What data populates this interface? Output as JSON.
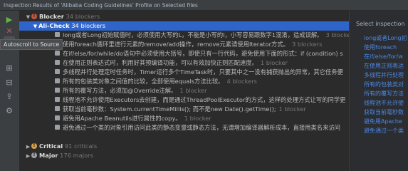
{
  "window": {
    "title": "Inspection Results of 'Alibaba Coding Guidelines' Profile on Selected files"
  },
  "toolbar": {
    "tooltip": "Autoscroll to Source",
    "buttons": [
      {
        "icon": "rerun-icon",
        "glyph": "▶"
      },
      {
        "icon": "close-icon",
        "glyph": "✕"
      },
      {
        "icon": "autoscroll-icon",
        "glyph": "⇥"
      },
      {
        "icon": "expand-all-icon",
        "glyph": "⊞"
      },
      {
        "icon": "collapse-all-icon",
        "glyph": "⊟"
      },
      {
        "icon": "export-icon",
        "glyph": "⇪"
      },
      {
        "icon": "filter-icon",
        "glyph": "⚙"
      },
      {
        "icon": "settings-icon",
        "glyph": "⚙"
      }
    ]
  },
  "tree": {
    "blocker_group": {
      "label": "Blocker",
      "count": "34 blockers"
    },
    "alicheck": {
      "label": "Ali-Check",
      "count": "34 blockers"
    },
    "items": [
      {
        "text": "long或者Long初始赋值时，必须使用大写的L，不能是小写的l，小写容易跟数字1混淆，造成误解。",
        "count": "3 blockers"
      },
      {
        "text": "使用foreach循环里进行元素的remove/add操作，remove元素请使用Iterator方式。",
        "count": "3 blockers"
      },
      {
        "text": "在if/else/for/while/do语句中必须使用大括号，即使只有一行代码，避免使用下面的形式：if (condition) s",
        "count": ""
      },
      {
        "text": "在使用正则表达式时，利用好其预编译功能，可以有效加快正则匹配速度。",
        "count": "1 blocker"
      },
      {
        "text": "多线程并行处理定时任务时，Timer运行多个TimeTask时，只要其中之一没有捕获抛出的异常，其它任务便",
        "count": ""
      },
      {
        "text": "所有的包装类对象之间值的比较，全部使用equals方法比较。",
        "count": "4 blockers"
      },
      {
        "text": "所有的覆写方法，必须加@Override注解。",
        "count": "1 blocker"
      },
      {
        "text": "线程池不允许使用Executors去创建，而是通过ThreadPoolExecutor的方式，这样的处理方式让写的同学更",
        "count": ""
      },
      {
        "text": "获取当前毫秒数：System.currentTimeMillis(); 而不是new Date().getTime();",
        "count": "1 blocker"
      },
      {
        "text": "避免用Apache Beanutils进行属性的copy。",
        "count": "1 blocker"
      },
      {
        "text": "避免通过一个类的对象引用访问此类的静态变量或静态方法，无谓增加编译器解析成本，直接用类名来访问",
        "count": ""
      }
    ],
    "critical_group": {
      "label": "Critical",
      "count": "91 criticals"
    },
    "major_group": {
      "label": "Major",
      "count": "176 majors"
    }
  },
  "right_panel": {
    "title": "Select inspection",
    "items": [
      "long或者Long初",
      "使用foreach",
      "在if/else/for/w",
      "在使用正则表达",
      "多线程并行处理",
      "所有的包装类对",
      "所有的覆写方法",
      "线程池不允许使",
      "获取当前毫秒数",
      "避免用Apache",
      "避免通过一个类"
    ]
  },
  "colors": {
    "selection": "#2f65ca",
    "link": "#4c88e6",
    "blocker": "#c7543f",
    "critical": "#d9a343"
  }
}
